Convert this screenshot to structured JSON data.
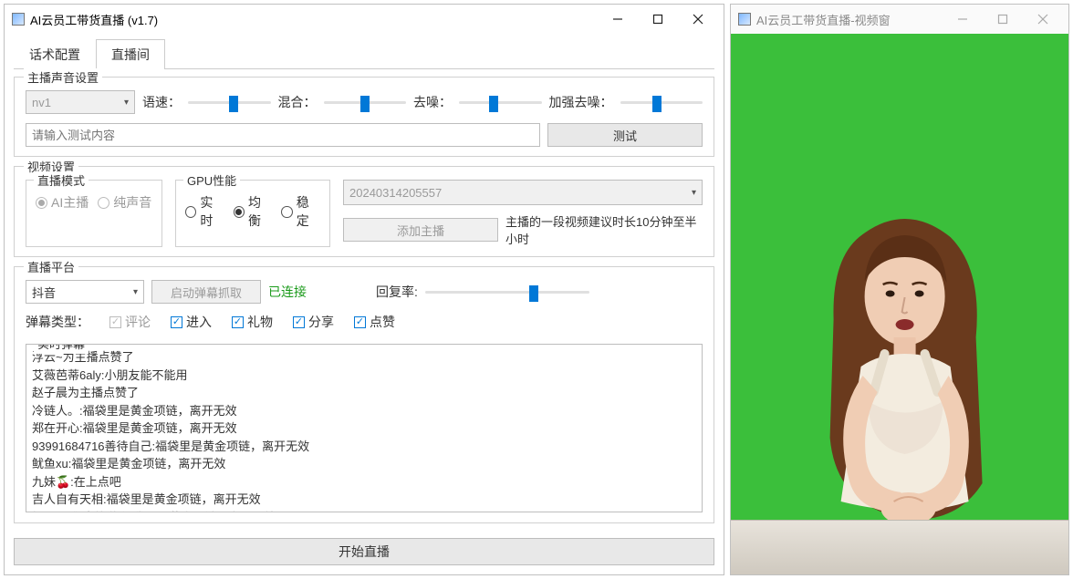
{
  "main_window": {
    "title": "AI云员工带货直播 (v1.7)",
    "tabs": [
      {
        "label": "话术配置"
      },
      {
        "label": "直播间"
      }
    ],
    "voice": {
      "group_title": "主播声音设置",
      "voice_select": "nv1",
      "sliders": {
        "speed": {
          "label": "语速：",
          "pos": 55
        },
        "mix": {
          "label": "混合：",
          "pos": 50
        },
        "denoise": {
          "label": "去噪：",
          "pos": 42
        },
        "strong": {
          "label": "加强去噪：",
          "pos": 45
        }
      },
      "test_placeholder": "请输入测试内容",
      "test_btn": "测试"
    },
    "video": {
      "group_title": "视频设置",
      "mode": {
        "title": "直播模式",
        "options": [
          {
            "label": "AI主播",
            "selected": true
          },
          {
            "label": "纯声音",
            "selected": false
          }
        ]
      },
      "gpu": {
        "title": "GPU性能",
        "options": [
          {
            "label": "实时",
            "selected": false
          },
          {
            "label": "均衡",
            "selected": true
          },
          {
            "label": "稳定",
            "selected": false
          }
        ]
      },
      "preset_select": "20240314205557",
      "add_presenter_btn": "添加主播",
      "hint": "主播的一段视频建议时长10分钟至半小时"
    },
    "platform": {
      "group_title": "直播平台",
      "platform_select": "抖音",
      "capture_btn": "启动弹幕抓取",
      "status": "已连接",
      "reply_rate_label": "回复率:",
      "reply_rate_pos": 66,
      "danmu_type_label": "弹幕类型：",
      "danmu_types": [
        {
          "label": "评论",
          "checked": true,
          "disabled": true
        },
        {
          "label": "进入",
          "checked": true
        },
        {
          "label": "礼物",
          "checked": true
        },
        {
          "label": "分享",
          "checked": true
        },
        {
          "label": "点赞",
          "checked": true
        }
      ],
      "danmu_legend": "实时弹幕",
      "danmu_lines": [
        "浮云~为主播点赞了",
        "艾薇芭蒂6aly:小朋友能不能用",
        "赵子晨为主播点赞了",
        "冷链人。:福袋里是黄金项链，离开无效",
        "郑在开心:福袋里是黄金项链，离开无效",
        "93991684716善待自己:福袋里是黄金项链，离开无效",
        "鱿鱼xu:福袋里是黄金项链，离开无效",
        "九妹🍒:在上点吧",
        "吉人自有天相:福袋里是黄金项链，离开无效",
        "杨哥:带你去旅游:福袋里是黄金项链，离开无效"
      ]
    },
    "start_btn": "开始直播"
  },
  "video_window": {
    "title": "AI云员工带货直播-视频窗"
  }
}
